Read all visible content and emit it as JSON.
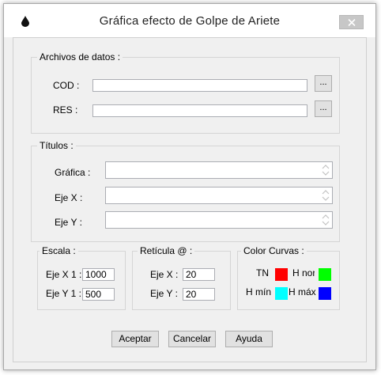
{
  "window": {
    "title": "Gráfica efecto de Golpe de Ariete"
  },
  "files_group": {
    "legend": "Archivos de datos :",
    "cod_label": "COD :",
    "cod_value": "",
    "res_label": "RES :",
    "res_value": "",
    "browse_label": "..."
  },
  "titles_group": {
    "legend": "Títulos :",
    "chart_label": "Gráfica :",
    "chart_value": "",
    "x_label": "Eje X :",
    "x_value": "",
    "y_label": "Eje Y :",
    "y_value": ""
  },
  "scale_group": {
    "legend": "Escala :",
    "x_label": "Eje X 1 :",
    "x_value": "1000",
    "y_label": "Eje Y  1 :",
    "y_value": "500"
  },
  "grid_group": {
    "legend": "Retícula @ :",
    "x_label": "Eje X :",
    "x_value": "20",
    "y_label": "Eje Y :",
    "y_value": "20"
  },
  "colors_group": {
    "legend": "Color Curvas :",
    "tn_label": "TN",
    "tn_color": "#ff0000",
    "hnor_label": "H nor",
    "hnor_color": "#00ff00",
    "hmin_label": "H mín",
    "hmin_color": "#00ffff",
    "hmax_label": "H máx",
    "hmax_color": "#0000ff"
  },
  "buttons": {
    "accept": "Aceptar",
    "cancel": "Cancelar",
    "help": "Ayuda"
  },
  "icons": {
    "app": "drop-icon",
    "close": "close-icon"
  }
}
